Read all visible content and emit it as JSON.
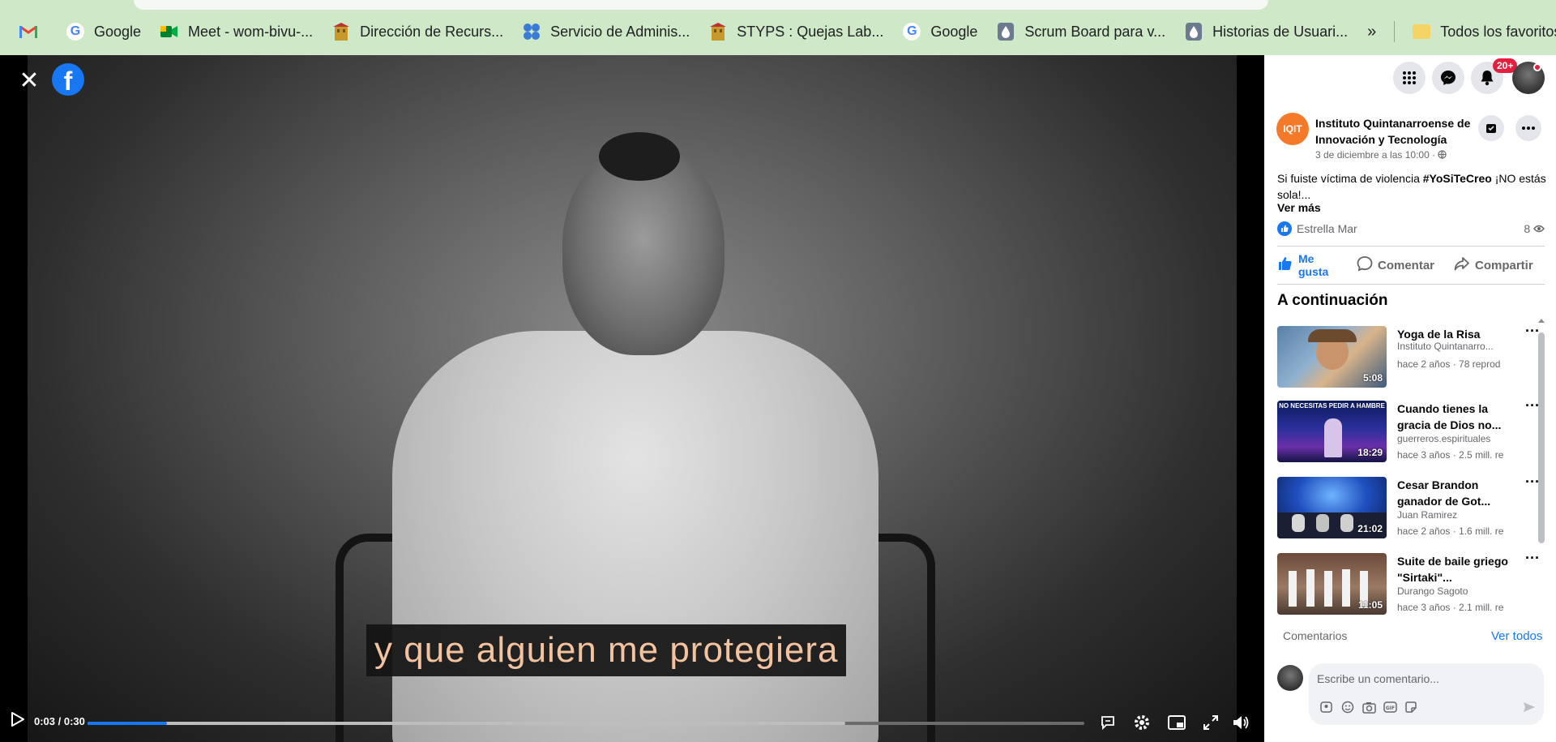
{
  "bookmarks": {
    "items": [
      {
        "label": "",
        "icon": "gmail-icon"
      },
      {
        "label": "Google",
        "icon": "google-icon"
      },
      {
        "label": "Meet - wom-bivu-...",
        "icon": "meet-icon"
      },
      {
        "label": "Dirección de Recurs...",
        "icon": "building-icon"
      },
      {
        "label": "Servicio de Adminis...",
        "icon": "sat-icon"
      },
      {
        "label": "STYPS : Quejas Lab...",
        "icon": "building-icon"
      },
      {
        "label": "Google",
        "icon": "google-icon"
      },
      {
        "label": "Scrum Board para v...",
        "icon": "drop-icon"
      },
      {
        "label": "Historias de Usuari...",
        "icon": "drop-icon"
      }
    ],
    "more": "»",
    "all_favorites": "Todos los favoritos"
  },
  "video": {
    "subtitle": "y que alguien me protegiera",
    "time": "0:03 / 0:30",
    "progress": 0.08,
    "buffered": 0.76
  },
  "panel": {
    "notif_count": "20+",
    "post": {
      "author": "Instituto Quintanarroense de Innovación y Tecnología",
      "date": "3 de diciembre a las 10:00 · ",
      "text_before": "Si fuiste víctima de violencia ",
      "hashtag": "#YoSiTeCreo",
      "text_after": " ¡NO estás sola!...",
      "see_more": "Ver más",
      "liker": "Estrella Mar",
      "views": "8"
    },
    "actions": {
      "like": "Me gusta",
      "comment": "Comentar",
      "share": "Compartir"
    },
    "up_next_title": "A continuación",
    "recommendations": [
      {
        "title": "Yoga de la Risa",
        "channel": "Instituto Quintanarro...",
        "meta": "hace 2 años · 78 reprod",
        "duration": "5:08"
      },
      {
        "title": "Cuando tienes la gracia de Dios no...",
        "channel": "guerreros.espirituales",
        "meta": "hace 3 años · 2.5 mill. re",
        "duration": "18:29"
      },
      {
        "title": "Cesar Brandon ganador de Got...",
        "channel": "Juan Ramirez",
        "meta": "hace 2 años · 1.6 mill. re",
        "duration": "21:02"
      },
      {
        "title": "Suite de baile griego \"Sirtaki\"...",
        "channel": "Durango Sagoto",
        "meta": "hace 3 años · 2.1 mill. re",
        "duration": "11:05"
      }
    ],
    "comments_label": "Comentarios",
    "see_all": "Ver todos",
    "comment_placeholder": "Escribe un comentario..."
  },
  "colors": {
    "facebook_blue": "#1877f2",
    "bookmarks_bg": "#cfe8c8",
    "badge_red": "#e41e3f",
    "subtitle_text": "#f3c3a0"
  }
}
